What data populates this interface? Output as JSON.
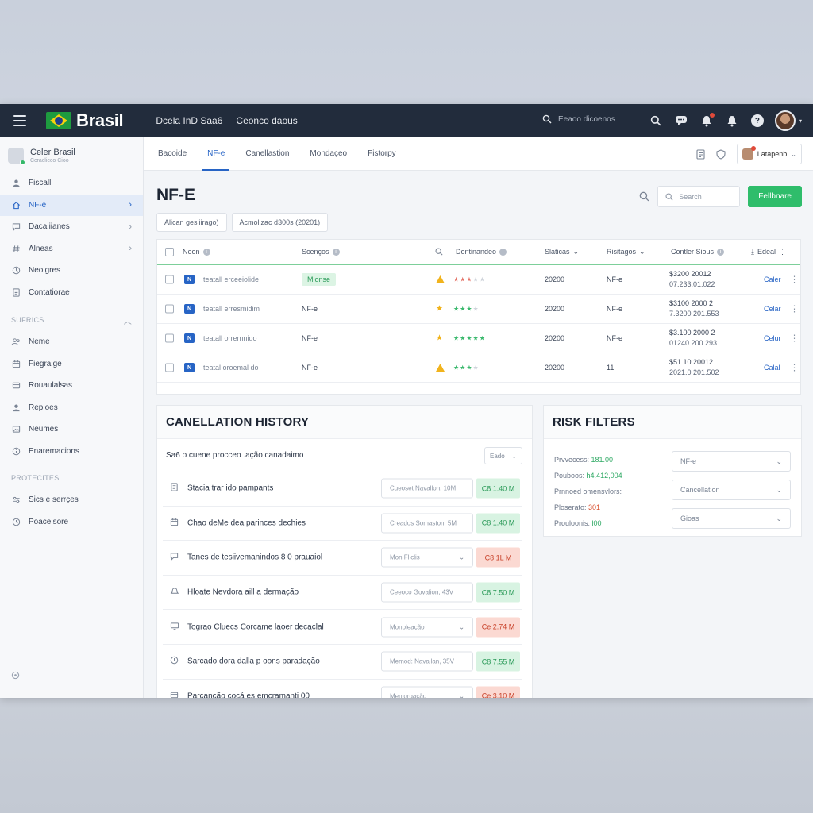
{
  "topbar": {
    "brand": "Brasil",
    "title": "Dcela InD Saa6",
    "subtitle": "Ceonco daous",
    "search_placeholder": "Eeaoo dicoenos"
  },
  "sidebar": {
    "user": {
      "name": "Celer Brasil",
      "sub": "Ccraclicco Cioo"
    },
    "items_top": [
      {
        "label": "Fiscall",
        "icon": "user-icon",
        "chevron": false
      },
      {
        "label": "NF-e",
        "icon": "home-icon",
        "chevron": true,
        "active": true
      },
      {
        "label": "Dacaliianes",
        "icon": "chat-icon",
        "chevron": true
      },
      {
        "label": "Alneas",
        "icon": "hash-icon",
        "chevron": true
      },
      {
        "label": "Neolgres",
        "icon": "clock-icon",
        "chevron": false
      },
      {
        "label": "Contatiorae",
        "icon": "document-icon",
        "chevron": false
      }
    ],
    "section1": "SUFRICS",
    "items_mid": [
      {
        "label": "Neme",
        "icon": "people-icon"
      },
      {
        "label": "Fiegralge",
        "icon": "calendar-icon"
      },
      {
        "label": "Rouaulalsas",
        "icon": "card-icon"
      },
      {
        "label": "Repioes",
        "icon": "user-icon"
      },
      {
        "label": "Neumes",
        "icon": "image-icon"
      },
      {
        "label": "Enaremacions",
        "icon": "info-icon"
      }
    ],
    "section2": "PROTECITES",
    "items_bottom": [
      {
        "label": "Sics e serrçes",
        "icon": "sliders-icon"
      },
      {
        "label": "Poacelsore",
        "icon": "clock-icon"
      }
    ]
  },
  "tabs": [
    {
      "label": "Bacoide",
      "active": false
    },
    {
      "label": "NF-e",
      "active": true
    },
    {
      "label": "Canellastion",
      "active": false
    },
    {
      "label": "Mondaçeo",
      "active": false
    },
    {
      "label": "Fistorpy",
      "active": false
    }
  ],
  "tab_tools": {
    "user_label": "Latapenb"
  },
  "page": {
    "title": "NF-E",
    "search_placeholder": "Search",
    "primary_button": "Fellbnare",
    "chips": [
      "Alican gesliirago)",
      "Acmolizac d300s (20201)"
    ]
  },
  "table": {
    "headers": [
      "Neon",
      "Scenços",
      "Dontinandeo",
      "Slaticas",
      "Risitagos",
      "Contler Sious",
      "Edeal"
    ],
    "rows": [
      {
        "name": "teatall erceeiolide",
        "status": "Mlonse",
        "status_badge": true,
        "alert": "warning",
        "stars": [
          [
            "#e57368",
            3
          ],
          [
            "#cfd4db",
            2
          ]
        ],
        "year": "20200",
        "type": "NF-e",
        "amount": "$3200 20012",
        "amount_sub": "07.233.01.022",
        "action": "Caler"
      },
      {
        "name": "teatall erresmidim",
        "status": "NF-e",
        "status_badge": false,
        "alert": "star",
        "stars": [
          [
            "#3ab96d",
            3
          ],
          [
            "#cfd4db",
            1
          ]
        ],
        "year": "20200",
        "type": "NF-e",
        "amount": "$3100 2000 2",
        "amount_sub": "7.3200 201.553",
        "action": "Celar"
      },
      {
        "name": "teatall orrernnido",
        "status": "NF-e",
        "status_badge": false,
        "alert": "star",
        "stars": [
          [
            "#3ab96d",
            5
          ],
          [
            "#cfd4db",
            0
          ]
        ],
        "year": "20200",
        "type": "NF-e",
        "amount": "$3.100 2000 2",
        "amount_sub": "01240 200.293",
        "action": "Celur"
      },
      {
        "name": "teatal oroemal do",
        "status": "NF-e",
        "status_badge": false,
        "alert": "warning",
        "stars": [
          [
            "#3ab96d",
            3
          ],
          [
            "#cfd4db",
            1
          ]
        ],
        "year": "20200",
        "type": "11",
        "amount": "$51.10 20012",
        "amount_sub": "2021.0 201.502",
        "action": "Calal"
      }
    ]
  },
  "history": {
    "title": "CANELLATION HISTORY",
    "subtitle": "Sa6 o cuene procceo .ação canadaimo",
    "select": "Eado",
    "rows": [
      {
        "icon": "document-icon",
        "label": "Stacia trar ido pampants",
        "input": "Cueoset Navallon, 10M",
        "dropdown": false,
        "value": "C8 1.40 M",
        "tone": "green"
      },
      {
        "icon": "calendar-icon",
        "label": "Chao deMe dea parinces dechies",
        "input": "Creados Somaston, 5M",
        "dropdown": false,
        "value": "C8 1.40 M",
        "tone": "green"
      },
      {
        "icon": "chat-icon",
        "label": "Tanes de tesiivemanindos 8 0 prauaiol",
        "input": "Mon Fliclis",
        "dropdown": true,
        "value": "C8 1L M",
        "tone": "red"
      },
      {
        "icon": "bell-icon",
        "label": "Hloate Nevdora aill a dermação",
        "input": "Ceeoco Govalion, 43V",
        "dropdown": false,
        "value": "C8 7.50 M",
        "tone": "green"
      },
      {
        "icon": "screen-icon",
        "label": "Tograo Cluecs Corcame laoer decaclal",
        "input": "Monoleação",
        "dropdown": true,
        "value": "Ce 2.74 M",
        "tone": "red"
      },
      {
        "icon": "clock-icon",
        "label": "Sarcado dora dalla p oons paradação",
        "input": "Memod: Navallan, 35V",
        "dropdown": false,
        "value": "C8 7.55 M",
        "tone": "green"
      },
      {
        "icon": "card-icon",
        "label": "Parcanção cocá es emcramanti 00",
        "input": "Meniorgação",
        "dropdown": true,
        "value": "Ce 3.10 M",
        "tone": "red"
      }
    ]
  },
  "risk": {
    "title": "RISK FILTERS",
    "lines": [
      {
        "label": "Prvvecess:",
        "value": "181.00",
        "tone": "g"
      },
      {
        "label": "Pouboos:",
        "value": "h4.412,004",
        "tone": "g"
      },
      {
        "label": "Prnnoed omensvlors:",
        "value": "",
        "tone": ""
      },
      {
        "label": "Ploserato:",
        "value": "301",
        "tone": "r"
      },
      {
        "label": "Prouloonis:",
        "value": "l00",
        "tone": "g"
      }
    ],
    "selects": [
      "NF-e",
      "Cancellation",
      "Gioas"
    ]
  },
  "colors": {
    "accent": "#2764c5",
    "success": "#2fbd6b",
    "danger": "#d9502f",
    "topbar": "#222c3c"
  }
}
